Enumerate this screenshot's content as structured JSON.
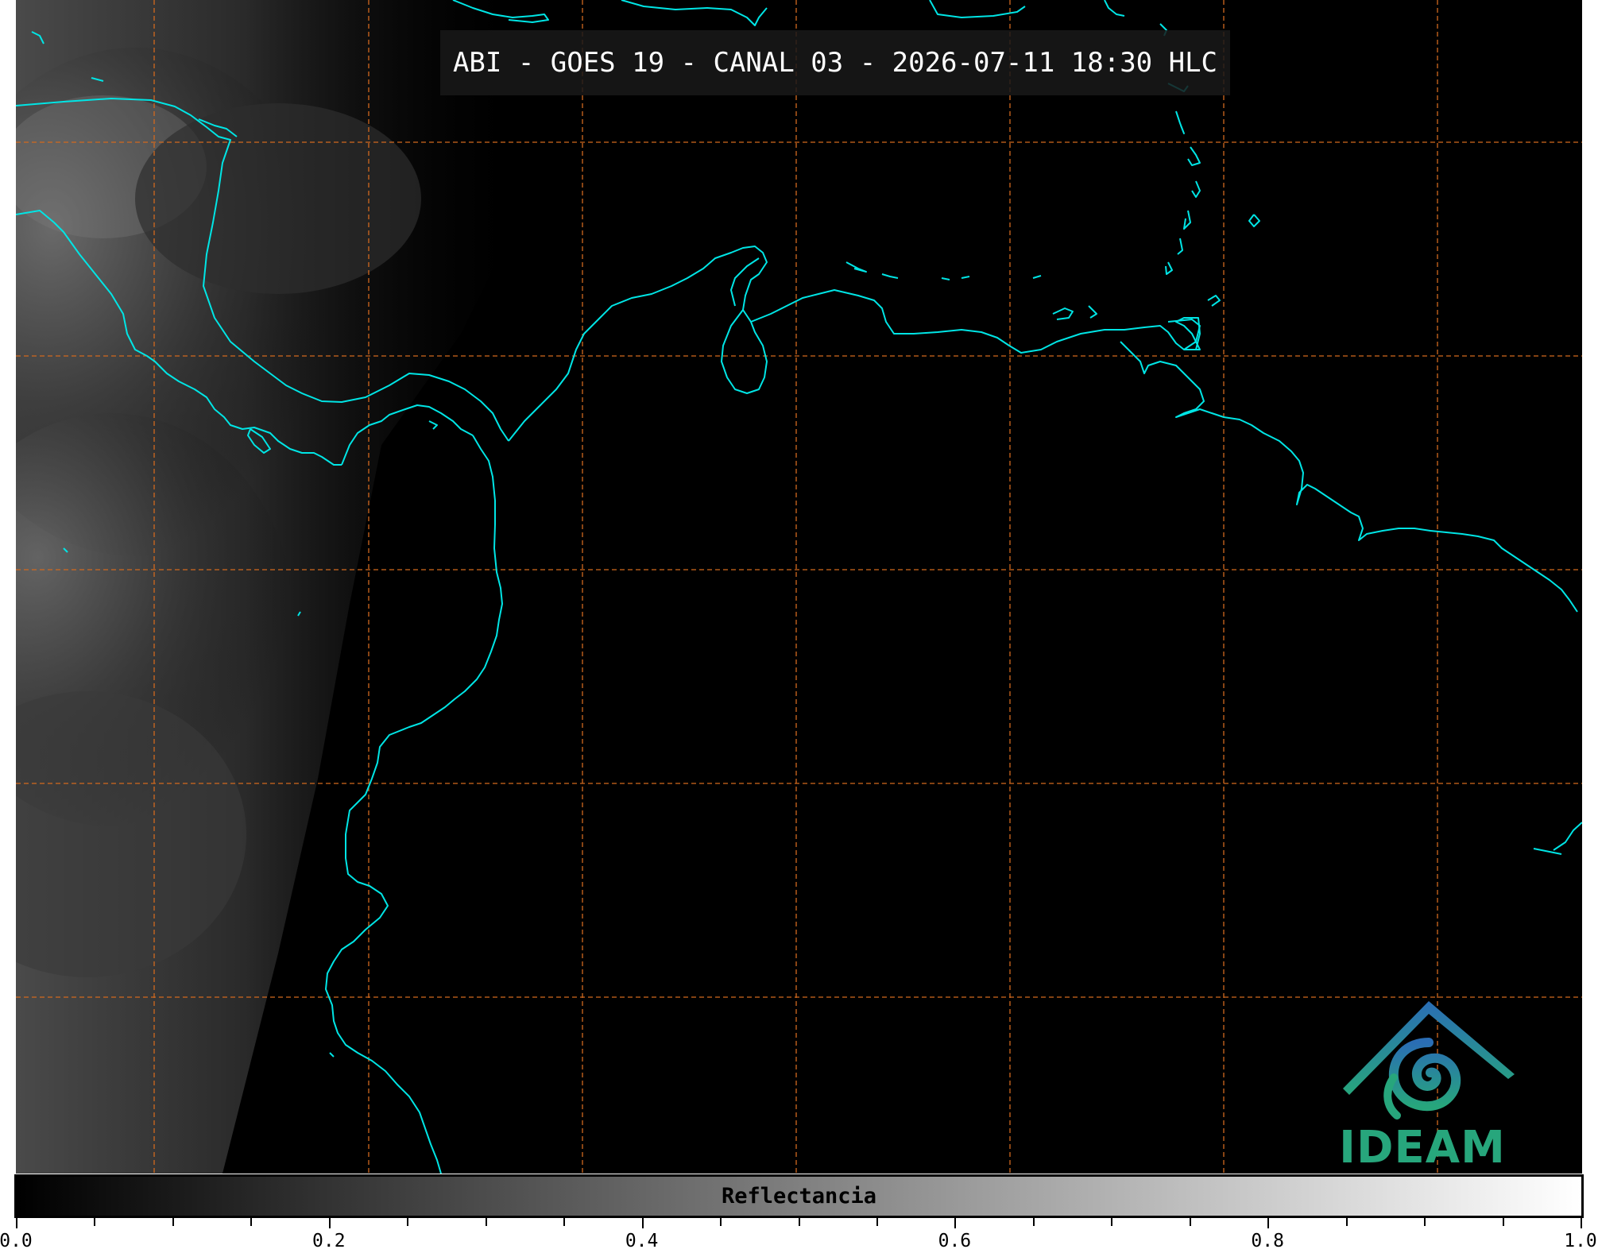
{
  "header": {
    "title": "ABI - GOES 19 - CANAL 03 - 2026-07-11 18:30 HLC"
  },
  "logo": {
    "text": "IDEAM",
    "icon": "ideam-mountain-spiral-logo"
  },
  "colorbar": {
    "label": "Reflectancia",
    "min": 0.0,
    "max": 1.0,
    "major_ticks": [
      "0.0",
      "0.2",
      "0.4",
      "0.6",
      "0.8",
      "1.0"
    ],
    "minor_step": 0.05,
    "colormap": "grayscale"
  },
  "colors": {
    "coastline": "#00e5e5",
    "gridlines": "#d2691e",
    "background": "#000000",
    "logo_green": "#27a67c",
    "logo_blue": "#2a6db5"
  }
}
